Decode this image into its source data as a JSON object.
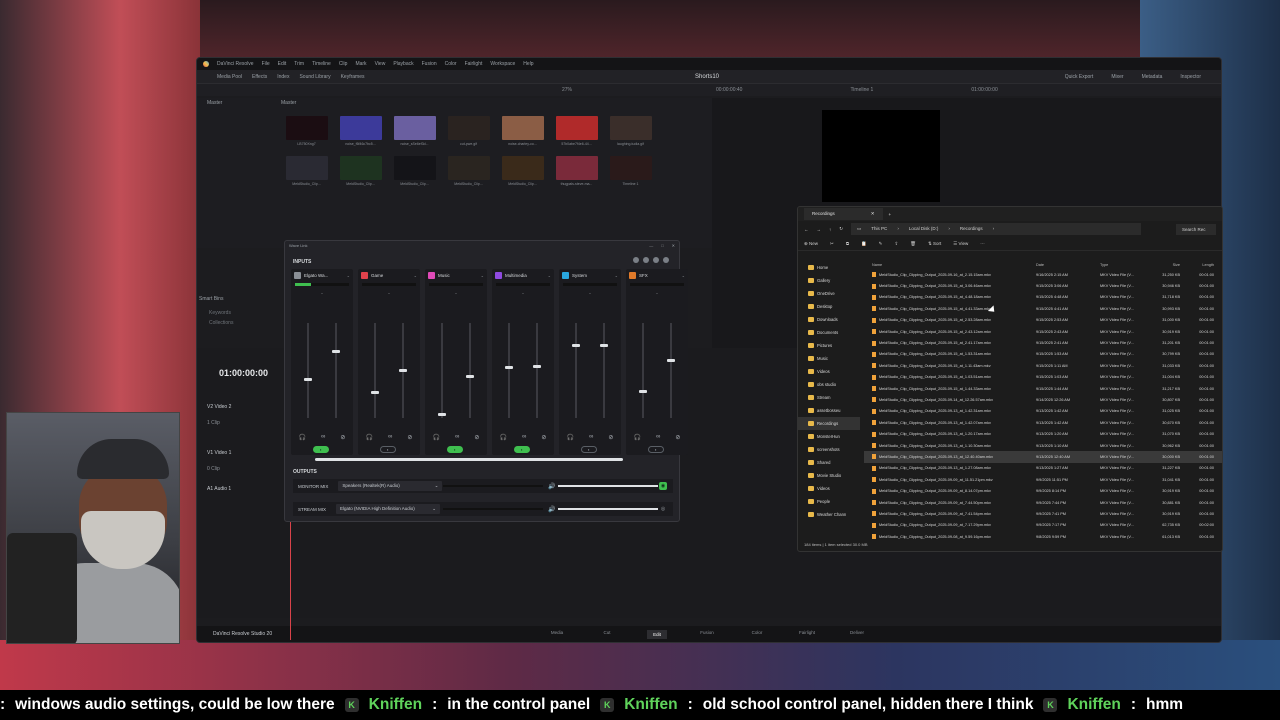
{
  "resolve": {
    "menu": [
      "DaVinci Resolve",
      "File",
      "Edit",
      "Trim",
      "Timeline",
      "Clip",
      "Mark",
      "View",
      "Playback",
      "Fusion",
      "Color",
      "Fairlight",
      "Workspace",
      "Help"
    ],
    "toolbar": {
      "media_pool": "Media Pool",
      "effects": "Effects",
      "index": "Index",
      "sound_library": "Sound Library",
      "keyframes": "Keyframes",
      "title": "Shorts10",
      "quick_export": "Quick Export",
      "mixer": "Mixer",
      "metadata": "Metadata",
      "inspector": "Inspector"
    },
    "subbar": {
      "zoom": "27%",
      "timecode": "00:00:00:40",
      "timeline": "Timeline 1",
      "end_tc": "01:00:00:00"
    },
    "media": {
      "master": "Master",
      "master2": "Master",
      "smart_bins": "Smart Bins",
      "keywords": "Keywords",
      "collections": "Collections"
    },
    "thumbs": [
      {
        "label": "LB750Xng7",
        "color": "#1b0d12"
      },
      {
        "label": "noise_f6f46c7bc5...",
        "color": "#3c3a9a"
      },
      {
        "label": "noise_sSe6ef3d...",
        "color": "#6a5fa0"
      },
      {
        "label": "cut-pwe.gif",
        "color": "#2a2320"
      },
      {
        "label": "noise-charley-co...",
        "color": "#8b5d45"
      },
      {
        "label": "57b0abe7f4e6-44...",
        "color": "#b02a2a"
      },
      {
        "label": "laughing-tudia.gif",
        "color": "#3a2e2a"
      },
      {
        "label": "MeldStudio_Clip...",
        "color": "#2a2a33"
      },
      {
        "label": "MeldStudio_Clip...",
        "color": "#1e3320"
      },
      {
        "label": "MeldStudio_Clip...",
        "color": "#141418"
      },
      {
        "label": "MeldStudio_Clip...",
        "color": "#2a2520"
      },
      {
        "label": "MeldStudio_Clip...",
        "color": "#3a2a1a"
      },
      {
        "label": "thugpals-steve-ma...",
        "color": "#7a2a3a"
      },
      {
        "label": "Timeline 1",
        "color": "#2a1a1a"
      }
    ],
    "timeline": {
      "timecode": "01:00:00:00",
      "tracks": [
        {
          "id": "V2",
          "name": "Video 2",
          "clips": "1 Clip"
        },
        {
          "id": "V1",
          "name": "Video 1",
          "clips": "0 Clip"
        },
        {
          "id": "A1",
          "name": "Audio 1",
          "clips": ""
        }
      ]
    },
    "pages": [
      "Media",
      "Cut",
      "Edit",
      "Fusion",
      "Color",
      "Fairlight",
      "Deliver"
    ],
    "active_page": "Edit",
    "brand": "DaVinci Resolve Studio 20"
  },
  "wavelink": {
    "title": "Wave Link",
    "inputs_label": "INPUTS",
    "channels": [
      {
        "name": "Elgato Wa...",
        "color": "#8a8f96",
        "pill": "on"
      },
      {
        "name": "Game",
        "color": "#e0424c",
        "pill": "off"
      },
      {
        "name": "Music",
        "color": "#e04ab8",
        "pill": "on"
      },
      {
        "name": "Multimedia",
        "color": "#8f4ae0",
        "pill": "on"
      },
      {
        "name": "System",
        "color": "#2aa8e0",
        "pill": "off"
      },
      {
        "name": "SFX",
        "color": "#e07a2a",
        "pill": "off"
      }
    ],
    "outputs_label": "OUTPUTS",
    "monitor": {
      "label": "MONITOR MIX",
      "device": "Speakers (Realtek(R) Audio)"
    },
    "stream": {
      "label": "STREAM MIX",
      "device": "Elgato (NVIDIA High Definition Audio)"
    }
  },
  "explorer": {
    "tab": "Recordings",
    "path": [
      "This PC",
      "Local Disk (D:)",
      "Recordings"
    ],
    "search": "Search Rec",
    "cmd": [
      "New",
      "Sort",
      "View"
    ],
    "nav": [
      "Home",
      "Gallery",
      "OneDrive",
      "Desktop",
      "Downloads",
      "Documents",
      "Pictures",
      "Music",
      "Videos",
      "obs studio",
      "Stream",
      "assetbosseu",
      "Recordings",
      "MonsterHun",
      "screenshots",
      "Shared",
      "Movie Studio",
      "Videos",
      "People",
      "Weather Chann"
    ],
    "columns": [
      "Name",
      "Date",
      "Type",
      "Size",
      "Length"
    ],
    "files": [
      [
        "MeldStudio_Clip_Clipping_Output_2025-09-16_at_2.15.15am.mkv",
        "9/16/2025 2:15 AM",
        "MKV Video File (V...",
        "31,250 KB",
        "00:01:00"
      ],
      [
        "MeldStudio_Clip_Clipping_Output_2025-09-15_at_3.06.46am.mkv",
        "9/15/2025 3:06 AM",
        "MKV Video File (V...",
        "30,946 KB",
        "00:01:00"
      ],
      [
        "MeldStudio_Clip_Clipping_Output_2025-09-15_at_4.48.18am.mkv",
        "9/15/2025 4:48 AM",
        "MKV Video File (V...",
        "31,718 KB",
        "00:01:00"
      ],
      [
        "MeldStudio_Clip_Clipping_Output_2025-09-15_at_4.41.33am.mkv",
        "9/15/2025 4:41 AM",
        "MKV Video File (V...",
        "30,993 KB",
        "00:01:00"
      ],
      [
        "MeldStudio_Clip_Clipping_Output_2025-09-15_at_2.53.28am.mkv",
        "9/15/2025 2:53 AM",
        "MKV Video File (V...",
        "31,000 KB",
        "00:01:00"
      ],
      [
        "MeldStudio_Clip_Clipping_Output_2025-09-15_at_2.43.12am.mkv",
        "9/15/2025 2:43 AM",
        "MKV Video File (V...",
        "30,919 KB",
        "00:01:00"
      ],
      [
        "MeldStudio_Clip_Clipping_Output_2025-09-15_at_2.41.17am.mkv",
        "9/15/2025 2:41 AM",
        "MKV Video File (V...",
        "31,201 KB",
        "00:01:00"
      ],
      [
        "MeldStudio_Clip_Clipping_Output_2025-09-15_at_1.53.31am.mkv",
        "9/15/2025 1:53 AM",
        "MKV Video File (V...",
        "30,799 KB",
        "00:01:00"
      ],
      [
        "MeldStudio_Clip_Clipping_Output_2025-09-15_at_1.11.43am.mkv",
        "9/15/2025 1:11 AM",
        "MKV Video File (V...",
        "31,033 KB",
        "00:01:00"
      ],
      [
        "MeldStudio_Clip_Clipping_Output_2025-09-15_at_1.03.51am.mkv",
        "9/15/2025 1:03 AM",
        "MKV Video File (V...",
        "31,004 KB",
        "00:01:00"
      ],
      [
        "MeldStudio_Clip_Clipping_Output_2025-09-15_at_1.44.33am.mkv",
        "9/15/2025 1:44 AM",
        "MKV Video File (V...",
        "31,217 KB",
        "00:01:00"
      ],
      [
        "MeldStudio_Clip_Clipping_Output_2025-09-14_at_12.26.57am.mkv",
        "9/14/2025 12:26 AM",
        "MKV Video File (V...",
        "30,807 KB",
        "00:01:00"
      ],
      [
        "MeldStudio_Clip_Clipping_Output_2025-09-13_at_1.42.31am.mkv",
        "9/13/2025 1:42 AM",
        "MKV Video File (V...",
        "31,025 KB",
        "00:01:00"
      ],
      [
        "MeldStudio_Clip_Clipping_Output_2025-09-13_at_1.42.07am.mkv",
        "9/13/2025 1:42 AM",
        "MKV Video File (V...",
        "30,670 KB",
        "00:01:00"
      ],
      [
        "MeldStudio_Clip_Clipping_Output_2025-09-13_at_1.20.17am.mkv",
        "9/13/2025 1:20 AM",
        "MKV Video File (V...",
        "31,070 KB",
        "00:01:00"
      ],
      [
        "MeldStudio_Clip_Clipping_Output_2025-09-13_at_1.10.30am.mkv",
        "9/13/2025 1:10 AM",
        "MKV Video File (V...",
        "30,962 KB",
        "00:01:00"
      ],
      [
        "MeldStudio_Clip_Clipping_Output_2025-09-13_at_12.40.40am.mkv",
        "9/13/2025 12:40 AM",
        "MKV Video File (V...",
        "30,000 KB",
        "00:01:00"
      ],
      [
        "MeldStudio_Clip_Clipping_Output_2025-09-13_at_1.27.08am.mkv",
        "9/13/2025 1:27 AM",
        "MKV Video File (V...",
        "31,227 KB",
        "00:01:00"
      ],
      [
        "MeldStudio_Clip_Clipping_Output_2025-09-09_at_11.51.21pm.mkv",
        "9/9/2025 11:51 PM",
        "MKV Video File (V...",
        "31,041 KB",
        "00:01:00"
      ],
      [
        "MeldStudio_Clip_Clipping_Output_2025-09-09_at_8.14.07pm.mkv",
        "9/9/2025 8:14 PM",
        "MKV Video File (V...",
        "30,919 KB",
        "00:01:00"
      ],
      [
        "MeldStudio_Clip_Clipping_Output_2025-09-09_at_7.44.50pm.mkv",
        "9/9/2025 7:44 PM",
        "MKV Video File (V...",
        "30,881 KB",
        "00:01:00"
      ],
      [
        "MeldStudio_Clip_Clipping_Output_2025-09-09_at_7.41.54pm.mkv",
        "9/9/2025 7:41 PM",
        "MKV Video File (V...",
        "30,919 KB",
        "00:01:00"
      ],
      [
        "MeldStudio_Clip_Clipping_Output_2025-09-09_at_7.17.29pm.mkv",
        "9/9/2025 7:17 PM",
        "MKV Video File (V...",
        "62,735 KB",
        "00:02:00"
      ],
      [
        "MeldStudio_Clip_Clipping_Output_2025-09-08_at_9.59.16pm.mkv",
        "9/8/2025 9:59 PM",
        "MKV Video File (V...",
        "61,013 KB",
        "00:01:00"
      ]
    ],
    "selected_row": 16,
    "status": "184 items  |  1 item selected  30.0 MB"
  },
  "captions": [
    {
      "user": "",
      "text": "windows audio settings, could be low there"
    },
    {
      "user": "Kniffen",
      "text": "in the control panel"
    },
    {
      "user": "Kniffen",
      "text": "old school control panel, hidden there I think"
    },
    {
      "user": "Kniffen",
      "text": "hmm"
    }
  ]
}
